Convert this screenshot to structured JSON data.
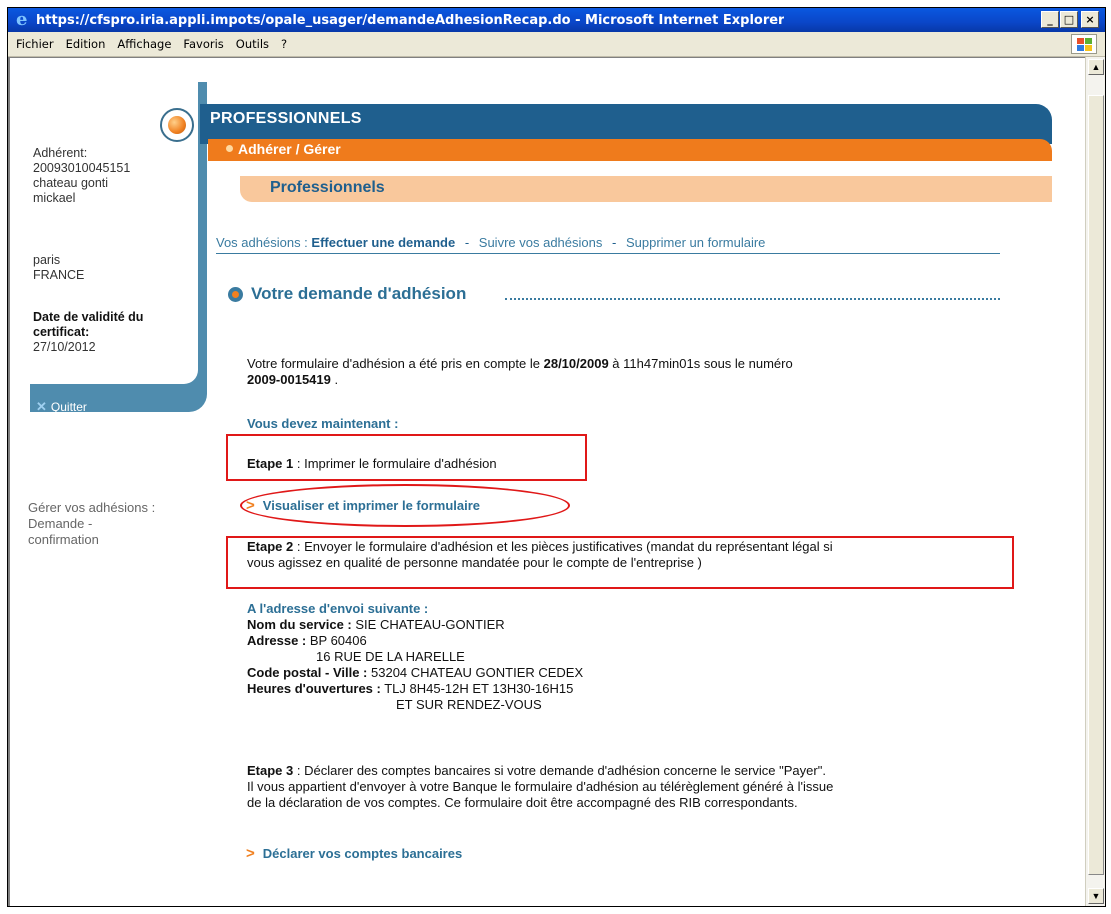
{
  "window": {
    "title": "https://cfspro.iria.appli.impots/opale_usager/demandeAdhesionRecap.do - Microsoft Internet Explorer",
    "minimize": "_",
    "maximize": "□",
    "close": "×"
  },
  "menu": [
    "Fichier",
    "Edition",
    "Affichage",
    "Favoris",
    "Outils",
    "?"
  ],
  "sidebar": {
    "adherent_label": "Adhérent:",
    "adherent_id": "20093010045151",
    "name_line1": "chateau gonti",
    "name_line2": "mickael",
    "city": "paris",
    "country": "FRANCE",
    "cert_label_line1": "Date de validité du",
    "cert_label_line2": "certificat:",
    "cert_date": "27/10/2012",
    "quit": "Quitter",
    "nav_line1": "Gérer vos adhésions :",
    "nav_line2": "Demande -",
    "nav_line3": "confirmation"
  },
  "header": {
    "brand": "PROFESSIONNELS",
    "section": "Adhérer / Gérer",
    "subsection": "Professionnels"
  },
  "nav": {
    "prefix": "Vos adhésions :",
    "item_1": "Effectuer une demande",
    "item_2": "Suivre vos adhésions",
    "item_3": "Supprimer un formulaire",
    "separator": "-"
  },
  "content": {
    "title": "Votre demande d'adhésion",
    "intro_pre": "Votre formulaire d'adhésion a été pris en compte le ",
    "intro_date": "28/10/2009",
    "intro_mid": " à 11h47min01s sous le numéro",
    "intro_number": "2009-0015419",
    "intro_end": " .",
    "must_now": "Vous devez maintenant :",
    "step1_label": "Etape 1",
    "step1_text": " : Imprimer le formulaire d'adhésion",
    "view_print_link": "Visualiser et imprimer le formulaire",
    "step2_label": "Etape 2",
    "step2_text": " : Envoyer le formulaire d'adhésion et les pièces justificatives (mandat du représentant légal si",
    "step2_text2": "vous agissez en qualité de personne mandatée pour le compte de l'entreprise )",
    "address_head": "A l'adresse d'envoi suivante :",
    "service_label": "Nom du service :",
    "service_value": " SIE CHATEAU-GONTIER",
    "address_label": "Adresse :",
    "address_value1": " BP 60406",
    "address_value2": "16 RUE DE LA HARELLE",
    "postal_label": "Code postal - Ville :",
    "postal_value": " 53204 CHATEAU GONTIER CEDEX",
    "hours_label": "Heures d'ouvertures :",
    "hours_value1": " TLJ 8H45-12H ET 13H30-16H15",
    "hours_value2": "ET SUR RENDEZ-VOUS",
    "step3_label": "Etape 3",
    "step3_text1": " : Déclarer  des comptes bancaires si votre demande d'adhésion concerne  le service \"Payer\".",
    "step3_text2": "Il vous appartient d'envoyer à votre Banque le formulaire  d'adhésion au télérèglement généré à l'issue",
    "step3_text3": "de la déclaration de vos comptes. Ce formulaire doit  être accompagné des RIB correspondants.",
    "declare_link": "Déclarer  vos comptes bancaires"
  },
  "colors": {
    "brand_blue": "#1f5f8e",
    "link_blue": "#2c6f95",
    "accent_orange": "#ef7b1c",
    "annotation_red": "#e01818"
  }
}
